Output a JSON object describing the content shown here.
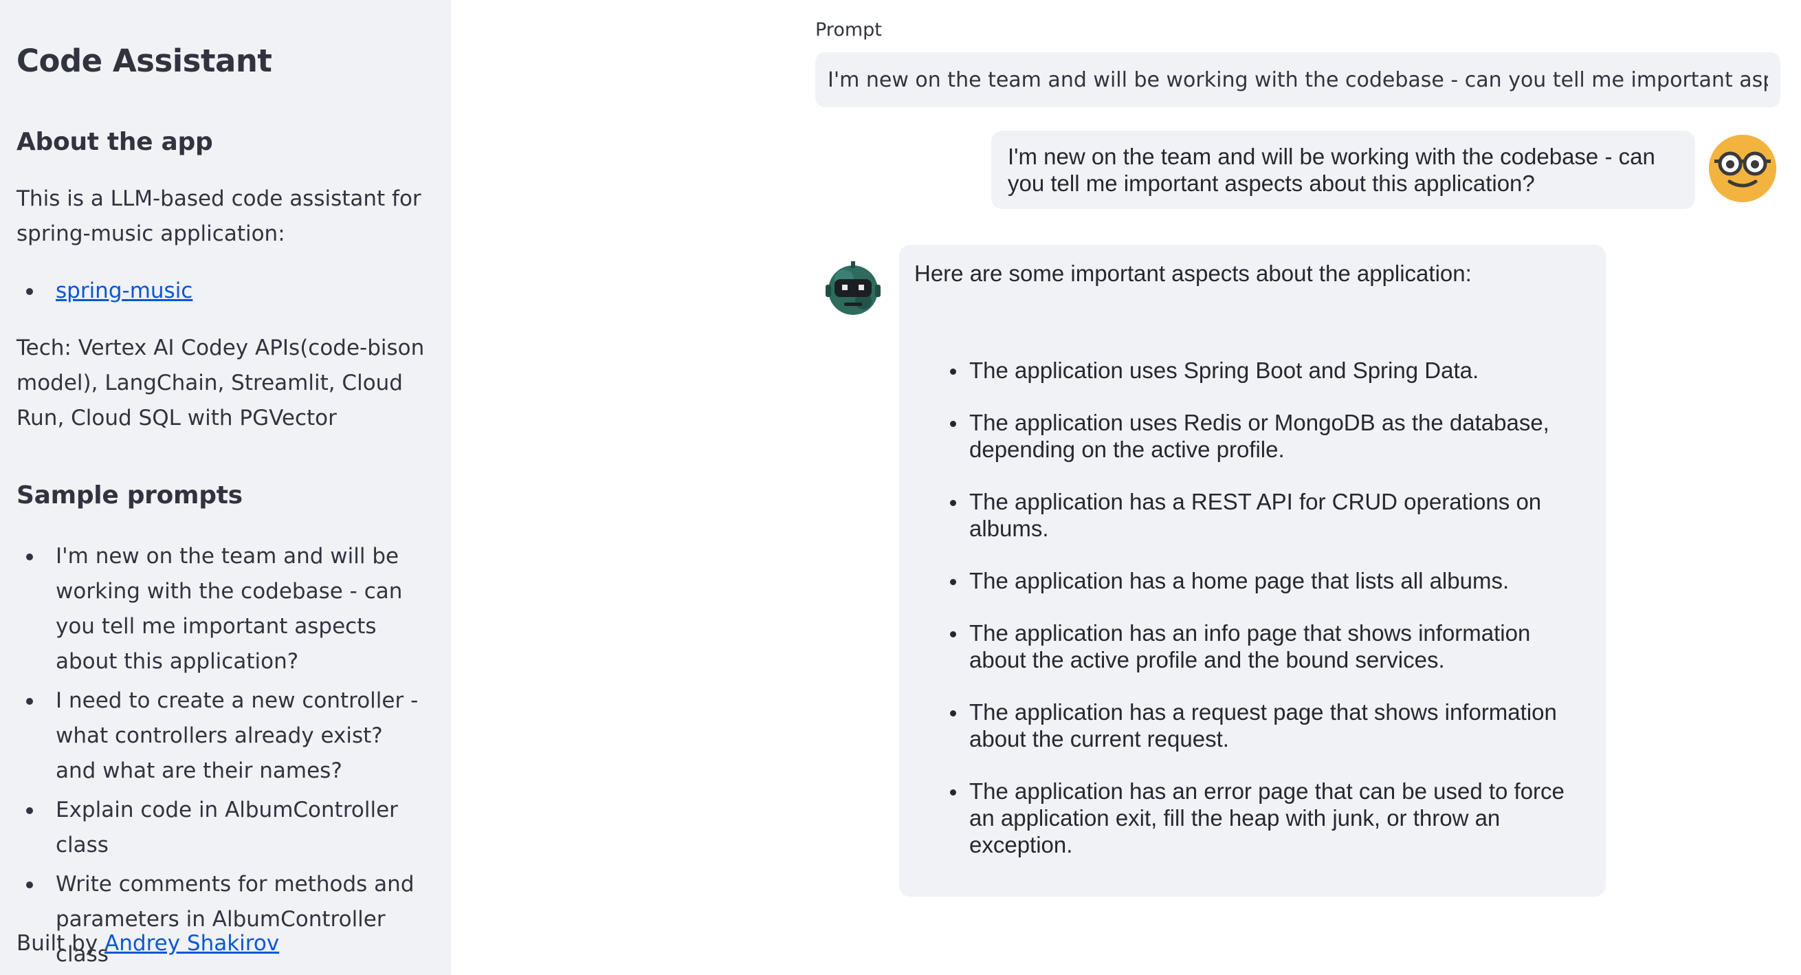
{
  "sidebar": {
    "title": "Code Assistant",
    "about_heading": "About the app",
    "about_text": "This is a LLM-based code assistant for spring-music application:",
    "links": [
      {
        "label": "spring-music"
      }
    ],
    "tech_text": "Tech: Vertex AI Codey APIs(code-bison model), LangChain, Streamlit, Cloud Run, Cloud SQL with PGVector",
    "samples_heading": "Sample prompts",
    "samples": [
      "I'm new on the team and will be working with the codebase - can you tell me important aspects about this application?",
      "I need to create a new controller - what controllers already exist? and what are their names?",
      "Explain code in AlbumController class",
      "Write comments for methods and parameters in AlbumController class"
    ],
    "built_by_prefix": "Built by ",
    "built_by_name": "Andrey Shakirov"
  },
  "prompt": {
    "label": "Prompt",
    "value": "I'm new on the team and will be working with the codebase - can you tell me important aspects about this application?"
  },
  "chat": {
    "user_message": "I'm new on the team and will be working with the codebase - can you tell me important aspects about this application?",
    "assistant_intro": "Here are some important aspects about the application:",
    "assistant_points": [
      "The application uses Spring Boot and Spring Data.",
      "The application uses Redis or MongoDB as the database, depending on the active profile.",
      "The application has a REST API for CRUD operations on albums.",
      "The application has a home page that lists all albums.",
      "The application has an info page that shows information about the active profile and the bound services.",
      "The application has a request page that shows information about the current request.",
      "The application has an error page that can be used to force an application exit, fill the heap with junk, or throw an exception."
    ]
  },
  "icons": {
    "user_avatar": "nerd-face-icon",
    "assistant_avatar": "robot-icon"
  },
  "colors": {
    "sidebar_bg": "#f0f2f6",
    "link": "#0b57d0",
    "user_avatar_bg": "#f3b33f",
    "bot_avatar": "#2e6b5e"
  }
}
